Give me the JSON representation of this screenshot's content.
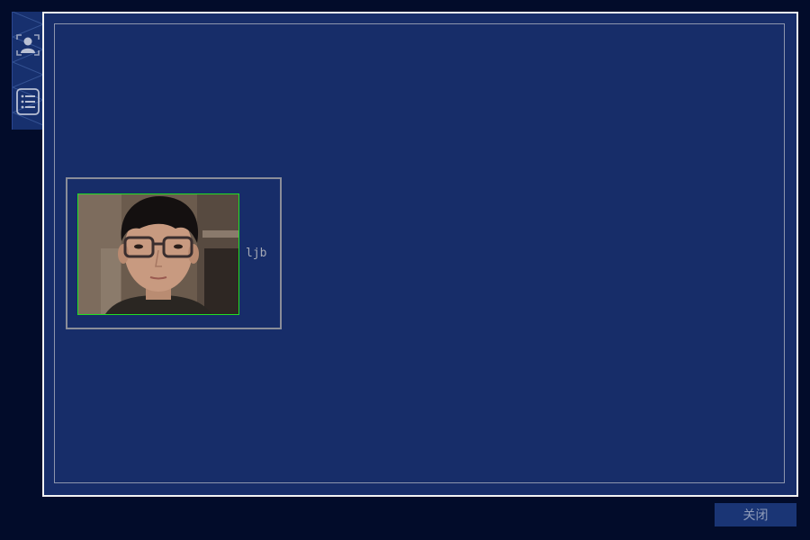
{
  "toolbar": {
    "items": [
      {
        "icon": "face-user-icon"
      },
      {
        "icon": "list-icon"
      }
    ]
  },
  "results": [
    {
      "name": "ljb"
    }
  ],
  "footer": {
    "close_label": "关闭"
  },
  "colors": {
    "background": "#020c2a",
    "panel": "#172d69",
    "panel_border": "#f2f2f2",
    "face_box": "#22e022",
    "button_bg": "#1a3575"
  }
}
